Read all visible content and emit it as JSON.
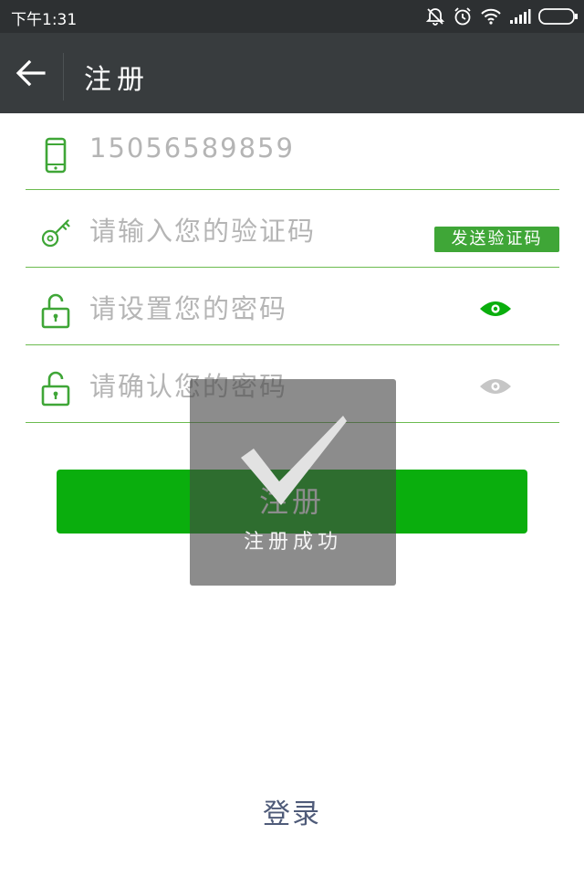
{
  "status_bar": {
    "time": "下午1:31",
    "icons": [
      "mute-icon",
      "alarm-icon",
      "wifi-icon",
      "signal-icon",
      "battery-icon"
    ]
  },
  "app_bar": {
    "title": "注册",
    "back_icon": "arrow-left-icon"
  },
  "form": {
    "phone": {
      "value": "15056589859",
      "icon": "phone-icon"
    },
    "code": {
      "placeholder": "请输入您的验证码",
      "icon": "key-icon",
      "send_button": "发送验证码"
    },
    "password": {
      "placeholder": "请设置您的密码",
      "icon": "unlock-icon",
      "eye_icon": "eye-icon"
    },
    "confirm": {
      "placeholder": "请确认您的密码",
      "icon": "unlock-icon",
      "eye_icon": "eye-icon"
    }
  },
  "register_button": "注册",
  "toast": {
    "message": "注册成功",
    "icon": "checkmark-icon"
  },
  "login_link": "登录",
  "colors": {
    "status_bar_bg": "#2d3032",
    "app_bar_bg": "#383c3e",
    "accent_green": "#0aae0d",
    "icon_green": "#3fa637",
    "divider_green": "#6cbb4f",
    "placeholder_gray": "#b5b5b5",
    "link_color": "#4f5b79"
  }
}
